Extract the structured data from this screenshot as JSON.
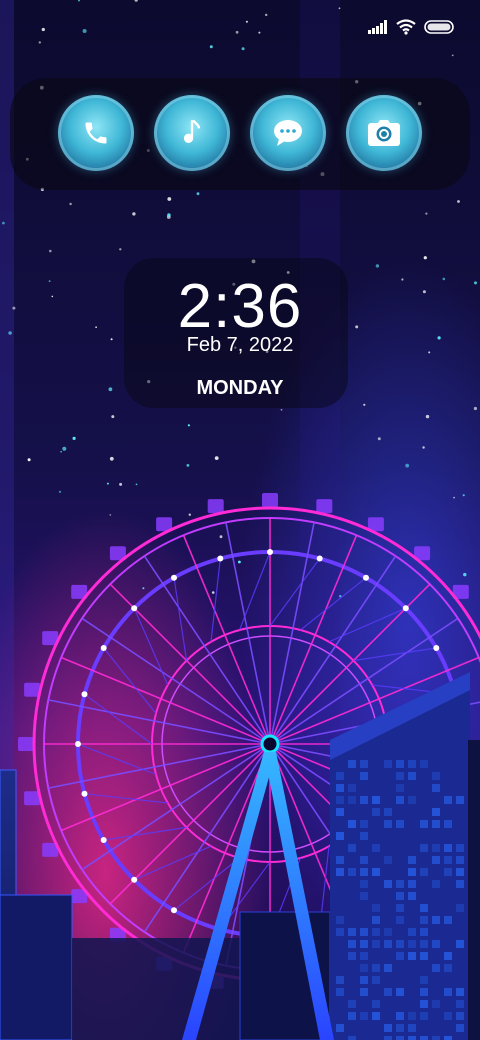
{
  "status_bar": {
    "icons": [
      "signal-icon",
      "wifi-icon",
      "battery-icon"
    ]
  },
  "dock": {
    "apps": [
      {
        "name": "Phone",
        "icon": "phone-icon"
      },
      {
        "name": "Music",
        "icon": "music-note-icon"
      },
      {
        "name": "Messages",
        "icon": "chat-bubble-icon"
      },
      {
        "name": "Camera",
        "icon": "camera-icon"
      }
    ]
  },
  "clock": {
    "time": "2:36",
    "date": "Feb 7, 2022",
    "day": "MONDAY"
  },
  "wallpaper": {
    "subject": "neon-ferris-wheel",
    "accent_pink": "#ff2bd6",
    "accent_blue": "#2a6bff",
    "hub_color": "#19e3ff"
  }
}
